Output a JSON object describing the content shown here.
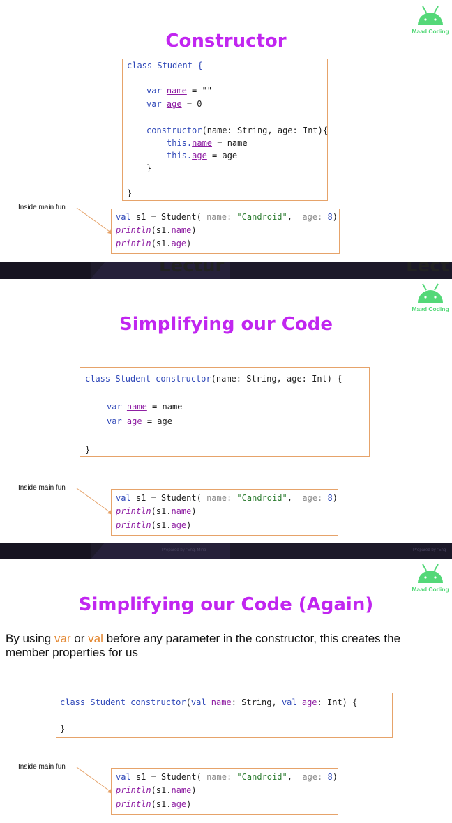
{
  "brand": {
    "logo_text": "Maad Coding",
    "color": "#54d878"
  },
  "colors": {
    "title": "#c126f0",
    "border": "#e6a36a",
    "keyword": "#2f48b8",
    "property": "#8f1fa3",
    "string": "#2e7d32",
    "hint": "#8a8a8a",
    "highlight": "#e3862f"
  },
  "slide1": {
    "title": "Constructor",
    "code": {
      "l1_class": "class Student {",
      "l2_var": "var",
      "l2_name": "name",
      "l2_rest": " = \"\"",
      "l3_var": "var",
      "l3_name": "age",
      "l3_rest": " = 0",
      "l4_ctor": "constructor",
      "l4_rest": "(name: String, age: Int){",
      "l5_this": "this.",
      "l5_name": "name",
      "l5_rest": " = name",
      "l6_this": "this.",
      "l6_name": "age",
      "l6_rest": " = age",
      "l7_brace": "}",
      "l8_brace": "}"
    }
  },
  "slide2": {
    "title": "Simplifying our Code",
    "code": {
      "l1_class": "class Student ",
      "l1_ctor": "constructor",
      "l1_rest": "(name: String, age: Int) {",
      "l2_var": "var",
      "l2_name": "name",
      "l2_rest": " = name",
      "l3_var": "var",
      "l3_name": "age",
      "l3_rest": " = age",
      "l4_brace": "}"
    }
  },
  "slide3": {
    "title": "Simplifying our Code (Again)",
    "description": {
      "p1": "By using ",
      "var": "var",
      "p2": " or ",
      "val": "val",
      "p3": " before any parameter in the constructor, this creates the member properties for us"
    },
    "code": {
      "l1_class": "class Student ",
      "l1_ctor": "constructor",
      "l1_paren": "(",
      "l1_val1": "val",
      "l1_name": " name",
      "l1_mid": ": String, ",
      "l1_val2": "val",
      "l1_age": " age",
      "l1_end": ": Int) {",
      "l2_brace": "}"
    }
  },
  "main_snippet": {
    "label": "Inside main fun",
    "l1_val": "val",
    "l1_mid": " s1 = Student(",
    "l1_hint_name": " name:",
    "l1_str": " \"Candroid\"",
    "l1_comma": ",",
    "l1_hint_age": "  age:",
    "l1_num": " 8",
    "l1_end": ")",
    "l2_fn": "println",
    "l2_open": "(s1.",
    "l2_prop": "name",
    "l2_close": ")",
    "l3_fn": "println",
    "l3_open": "(s1.",
    "l3_prop": "age",
    "l3_close": ")"
  },
  "bands": {
    "band1_left": "Lectur",
    "band1_right": "Lect",
    "band2_credit_left": "Prepared by \"Eng. Mina",
    "band2_credit_right": "Prepared by \"Eng"
  }
}
